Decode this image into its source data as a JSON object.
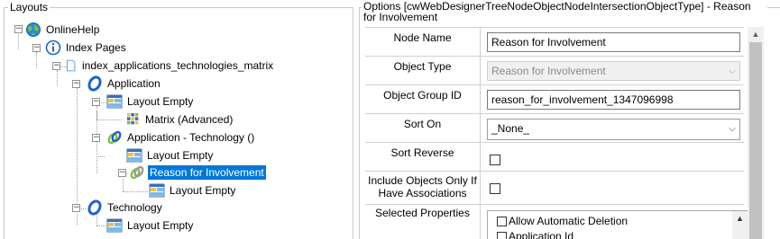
{
  "layouts_panel": {
    "title": "Layouts",
    "tree": {
      "online_help": "OnlineHelp",
      "index_pages": "Index Pages",
      "index_file": "index_applications_technologies_matrix",
      "application": "Application",
      "layout_empty_1": "Layout Empty",
      "matrix_advanced": "Matrix (Advanced)",
      "application_technology": "Application - Technology ()",
      "layout_empty_2": "Layout Empty",
      "reason_for_involvement": "Reason for Involvement",
      "layout_empty_3": "Layout Empty",
      "technology": "Technology",
      "layout_empty_4": "Layout Empty"
    }
  },
  "options_panel": {
    "title": "Options [cwWebDesignerTreeNodeObjectNodeIntersectionObjectType] - Reason for Involvement",
    "fields": {
      "node_name_label": "Node Name",
      "node_name_value": "Reason for Involvement",
      "object_type_label": "Object Type",
      "object_type_value": "Reason for Involvement",
      "object_group_id_label": "Object Group ID",
      "object_group_id_value": "reason_for_involvement_1347096998",
      "sort_on_label": "Sort On",
      "sort_on_value": "_None_",
      "sort_reverse_label": "Sort Reverse",
      "include_objects_label_1": "Include Objects Only If",
      "include_objects_label_2": "Have Associations",
      "selected_properties_label": "Selected Properties",
      "selected_properties_items": [
        "Allow Automatic Deletion",
        "Application Id"
      ]
    }
  },
  "icons": {
    "expand": "expand-icon",
    "globe": "globe-icon",
    "info": "info-icon",
    "page": "page-icon",
    "object_type": "object-type-icon",
    "layout": "layout-icon",
    "matrix": "matrix-icon",
    "intersection": "intersection-icon"
  },
  "colors": {
    "selection": "#0078d7",
    "object_ring": "#1f64c8"
  }
}
